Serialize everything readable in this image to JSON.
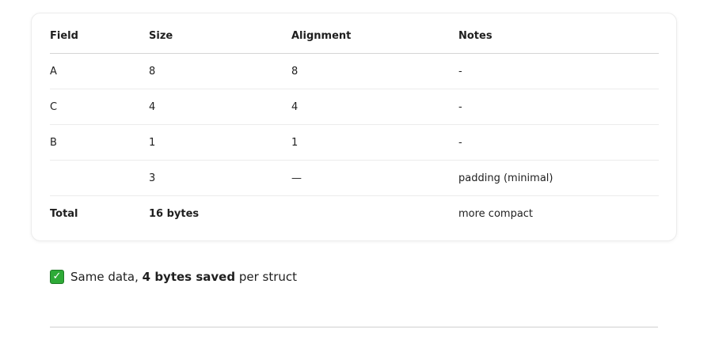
{
  "table": {
    "headers": [
      "Field",
      "Size",
      "Alignment",
      "Notes"
    ],
    "rows": [
      {
        "field": "A",
        "size": "8",
        "alignment": "8",
        "notes": "-"
      },
      {
        "field": "C",
        "size": "4",
        "alignment": "4",
        "notes": "-"
      },
      {
        "field": "B",
        "size": "1",
        "alignment": "1",
        "notes": "-"
      },
      {
        "field": "",
        "size": "3",
        "alignment": "—",
        "notes": "padding (minimal)"
      }
    ],
    "total": {
      "field": "Total",
      "size": "16 bytes",
      "alignment": "",
      "notes": "more compact"
    }
  },
  "summary": {
    "icon": "check-mark-icon",
    "icon_glyph": "✓",
    "prefix": "Same data, ",
    "bold": "4 bytes saved",
    "suffix": " per struct"
  },
  "colors": {
    "check_background": "#2eaa37"
  }
}
